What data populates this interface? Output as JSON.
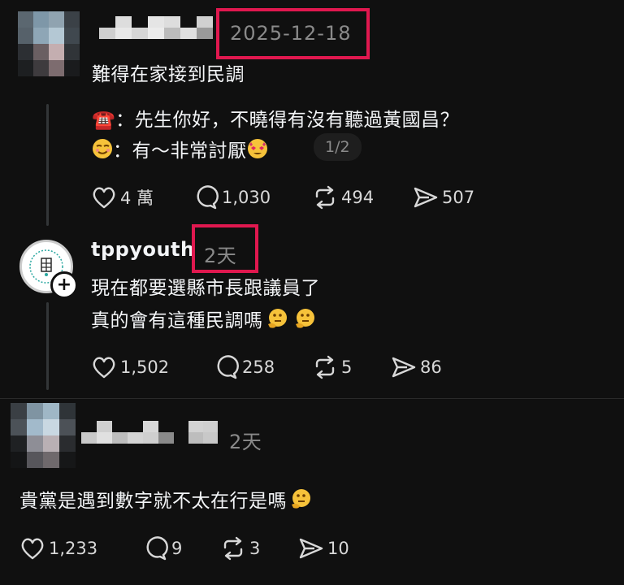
{
  "comment1": {
    "timestamp": "2025-12-18",
    "line1": "難得在家接到民調",
    "line2": "☎️：先生你好，不曉得有沒有聽過黃國昌？",
    "line3_prefix": "：有～非常討厭",
    "page_indicator": "1/2",
    "likes": "4 萬",
    "replies": "1,030",
    "reposts": "494",
    "shares": "507"
  },
  "comment2": {
    "username": "tppyouth",
    "timestamp": "2天",
    "line1": "現在都要選縣市長跟議員了",
    "line2": "真的會有這種民調嗎",
    "likes": "1,502",
    "replies": "258",
    "reposts": "5",
    "shares": "86"
  },
  "comment3": {
    "timestamp": "2天",
    "line1": "貴黨是遇到數字就不太在行是嗎",
    "likes": "1,233",
    "replies": "9",
    "reposts": "3",
    "shares": "10"
  },
  "colors": {
    "background": "#101010",
    "text": "#f3f5f7",
    "muted": "#777777",
    "highlight": "#e0184f"
  },
  "icons": [
    "heart-icon",
    "comment-icon",
    "repost-icon",
    "share-icon",
    "phone-icon",
    "smirk-emoji-icon",
    "star-eyes-emoji-icon",
    "thinking-emoji-icon",
    "plus-icon"
  ]
}
